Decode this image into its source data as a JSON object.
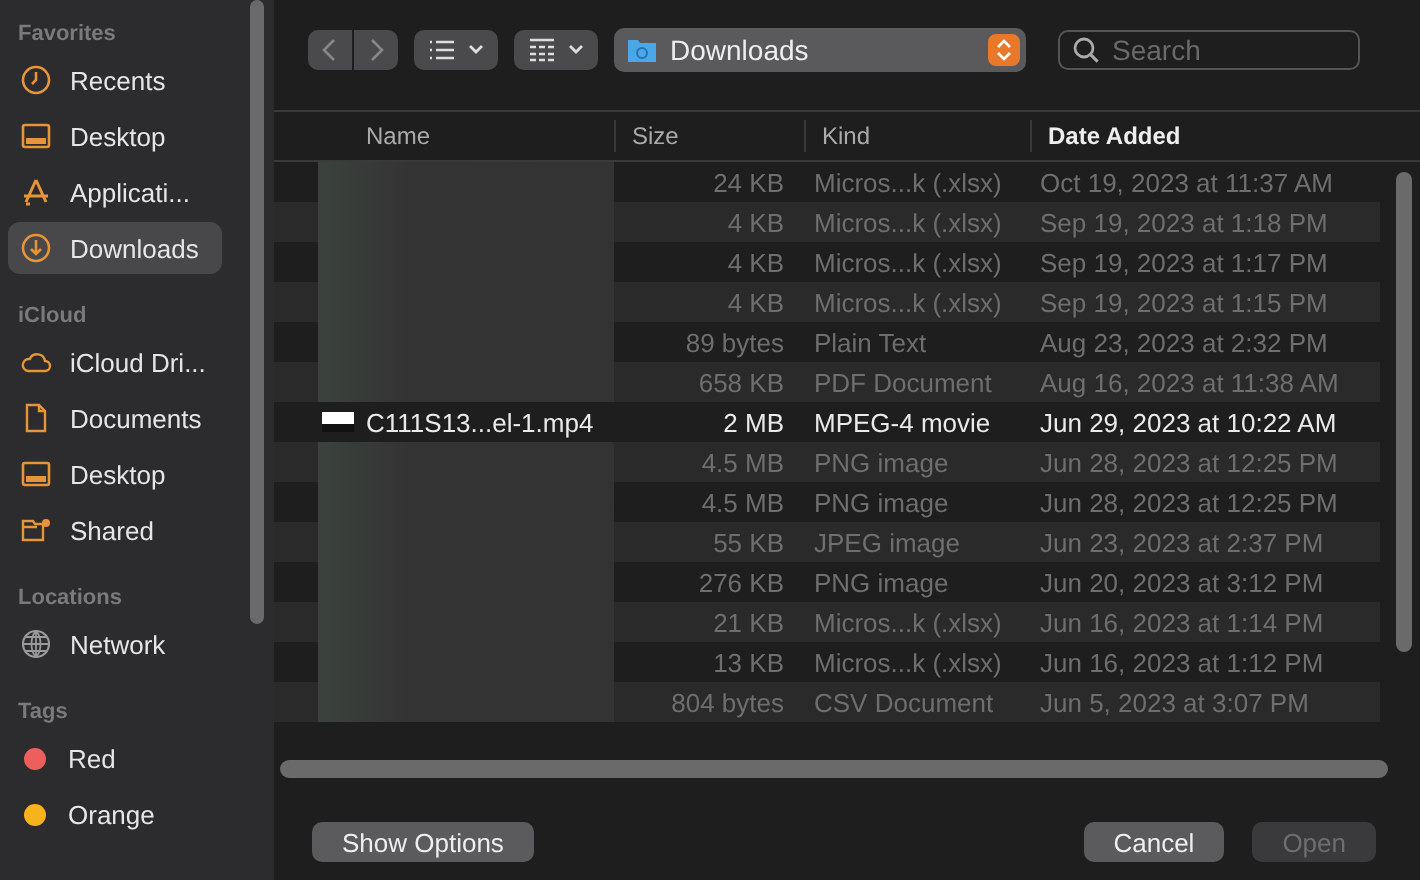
{
  "sidebar": {
    "sections": [
      {
        "title": "Favorites",
        "items": [
          {
            "label": "Recents",
            "selected": false
          },
          {
            "label": "Desktop",
            "selected": false
          },
          {
            "label": "Applicati...",
            "selected": false
          },
          {
            "label": "Downloads",
            "selected": true
          }
        ]
      },
      {
        "title": "iCloud",
        "items": [
          {
            "label": "iCloud Dri...",
            "selected": false
          },
          {
            "label": "Documents",
            "selected": false
          },
          {
            "label": "Desktop",
            "selected": false
          },
          {
            "label": "Shared",
            "selected": false
          }
        ]
      },
      {
        "title": "Locations",
        "items": [
          {
            "label": "Network",
            "selected": false
          }
        ]
      },
      {
        "title": "Tags",
        "items": [
          {
            "label": "Red",
            "selected": false,
            "color": "#ec5f5d"
          },
          {
            "label": "Orange",
            "selected": false,
            "color": "#f7b31b"
          }
        ]
      }
    ]
  },
  "toolbar": {
    "location": "Downloads",
    "search": {
      "placeholder": "Search"
    }
  },
  "table": {
    "columns": [
      {
        "label": "Name",
        "sorted": false
      },
      {
        "label": "Size",
        "sorted": false
      },
      {
        "label": "Kind",
        "sorted": false
      },
      {
        "label": "Date Added",
        "sorted": true
      }
    ],
    "rows": [
      {
        "size": "24 KB",
        "kind": "Micros...k (.xlsx)",
        "date": "Oct 19, 2023 at 11:37 AM",
        "disabled": true
      },
      {
        "size": "4 KB",
        "kind": "Micros...k (.xlsx)",
        "date": "Sep 19, 2023 at 1:18 PM",
        "disabled": true
      },
      {
        "size": "4 KB",
        "kind": "Micros...k (.xlsx)",
        "date": "Sep 19, 2023 at 1:17 PM",
        "disabled": true
      },
      {
        "size": "4 KB",
        "kind": "Micros...k (.xlsx)",
        "date": "Sep 19, 2023 at 1:15 PM",
        "disabled": true
      },
      {
        "size": "89 bytes",
        "kind": "Plain Text",
        "date": "Aug 23, 2023 at 2:32 PM",
        "disabled": true
      },
      {
        "size": "658 KB",
        "kind": "PDF Document",
        "date": "Aug 16, 2023 at 11:38 AM",
        "disabled": true
      },
      {
        "name": "C111S13...el-1.mp4",
        "size": "2 MB",
        "kind": "MPEG-4 movie",
        "date": "Jun 29, 2023 at 10:22 AM",
        "disabled": false
      },
      {
        "size": "4.5 MB",
        "kind": "PNG image",
        "date": "Jun 28, 2023 at 12:25 PM",
        "disabled": true
      },
      {
        "size": "4.5 MB",
        "kind": "PNG image",
        "date": "Jun 28, 2023 at 12:25 PM",
        "disabled": true
      },
      {
        "size": "55 KB",
        "kind": "JPEG image",
        "date": "Jun 23, 2023 at 2:37 PM",
        "disabled": true
      },
      {
        "size": "276 KB",
        "kind": "PNG image",
        "date": "Jun 20, 2023 at 3:12 PM",
        "disabled": true
      },
      {
        "size": "21 KB",
        "kind": "Micros...k (.xlsx)",
        "date": "Jun 16, 2023 at 1:14 PM",
        "disabled": true
      },
      {
        "size": "13 KB",
        "kind": "Micros...k (.xlsx)",
        "date": "Jun 16, 2023 at 1:12 PM",
        "disabled": true
      },
      {
        "size": "804 bytes",
        "kind": "CSV Document",
        "date": "Jun 5, 2023 at 3:07 PM",
        "disabled": true
      }
    ]
  },
  "buttons": [
    {
      "label": "Show Options",
      "disabled": false
    },
    {
      "label": "Cancel",
      "disabled": false
    },
    {
      "label": "Open",
      "disabled": true
    }
  ]
}
